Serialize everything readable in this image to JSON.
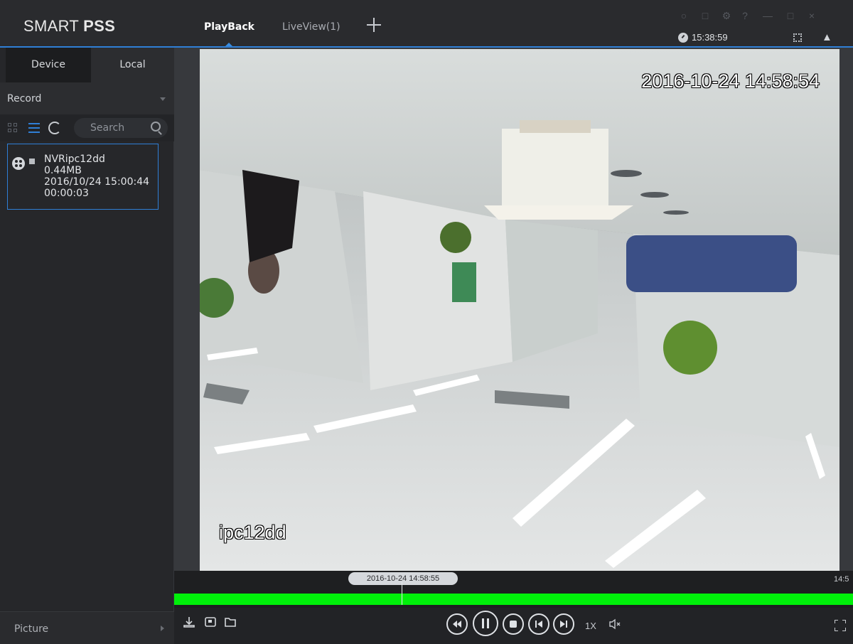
{
  "app": {
    "logo_regular": "SMART ",
    "logo_bold": "PSS"
  },
  "tabs": [
    {
      "label": "PlayBack",
      "active": true
    },
    {
      "label": "LiveView(1)",
      "active": false
    }
  ],
  "status": {
    "time": "15:38:59"
  },
  "sidebar": {
    "tabs": [
      "Device",
      "Local"
    ],
    "record_select": "Record",
    "search_placeholder": "Search",
    "records": [
      {
        "name": "NVRipc12dd",
        "size": "0.44MB",
        "datetime": "2016/10/24 15:00:44",
        "duration": "00:00:03"
      }
    ],
    "picture_label": "Picture"
  },
  "video": {
    "osd_timestamp": "2016-10-24 14:58:54",
    "osd_channel": "ipc12dd"
  },
  "timeline": {
    "current_time": "2016-10-24 14:58:55",
    "right_label": "14:5",
    "progress": 0.335
  },
  "playback": {
    "speed": "1X"
  },
  "colors": {
    "accent": "#2f7fd6",
    "timeline_green": "#00f00a",
    "background": "#202124"
  }
}
